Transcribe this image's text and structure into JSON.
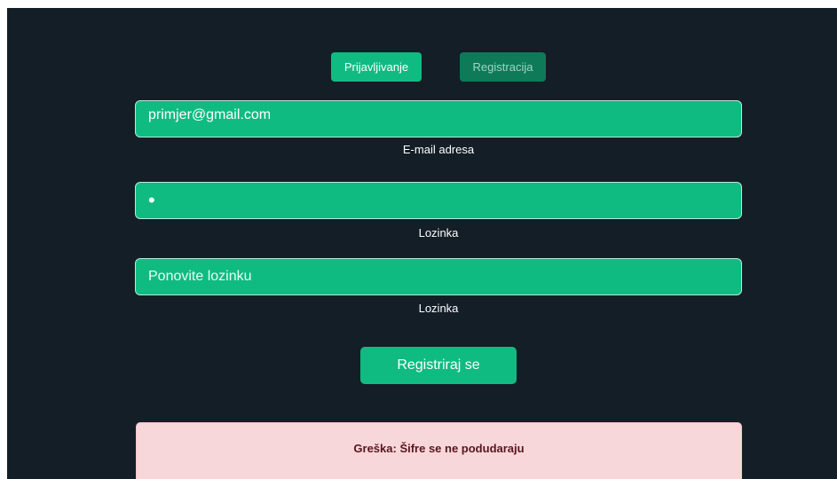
{
  "tabs": {
    "login_label": "Prijavljivanje",
    "register_label": "Registracija"
  },
  "form": {
    "email": {
      "value": "primjer@gmail.com",
      "label": "E-mail adresa"
    },
    "password": {
      "value": "a",
      "label": "Lozinka"
    },
    "confirm_password": {
      "value": "",
      "placeholder": "Ponovite lozinku",
      "label": "Lozinka"
    },
    "submit_label": "Registriraj se"
  },
  "alert": {
    "message": "Greška: Šifre se ne podudaraju"
  },
  "colors": {
    "background": "#141e26",
    "accent": "#10bb82",
    "inactive_tab": "#0f7a58",
    "alert_background": "#f8d7da",
    "alert_text": "#58151c"
  }
}
